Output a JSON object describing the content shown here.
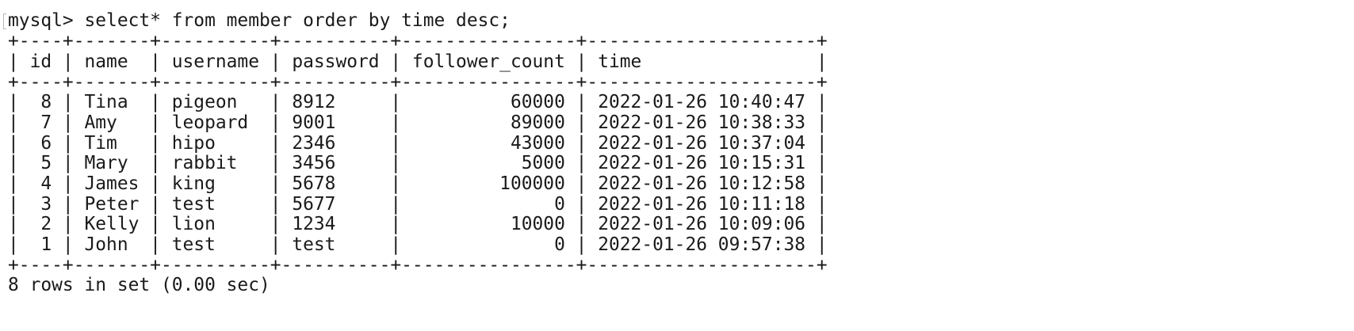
{
  "terminal": {
    "command": "mysql> select* from member order by time desc;",
    "border": "+----+-------+----------+----------+----------------+---------------------+",
    "header": "| id | name  | username | password | follower_count | time                |",
    "rows": [
      "|  8 | Tina  | pigeon   | 8912     |          60000 | 2022-01-26 10:40:47 |",
      "|  7 | Amy   | leopard  | 9001     |          89000 | 2022-01-26 10:38:33 |",
      "|  6 | Tim   | hipo     | 2346     |          43000 | 2022-01-26 10:37:04 |",
      "|  5 | Mary  | rabbit   | 3456     |           5000 | 2022-01-26 10:15:31 |",
      "|  4 | James | king     | 5678     |         100000 | 2022-01-26 10:12:58 |",
      "|  3 | Peter | test     | 5677     |              0 | 2022-01-26 10:11:18 |",
      "|  2 | Kelly | lion     | 1234     |          10000 | 2022-01-26 10:09:06 |",
      "|  1 | John  | test     | test     |              0 | 2022-01-26 09:57:38 |"
    ],
    "footer": "8 rows in set (0.00 sec)"
  },
  "colors": {
    "background": "#ffffff",
    "text": "#1a1a1a"
  }
}
